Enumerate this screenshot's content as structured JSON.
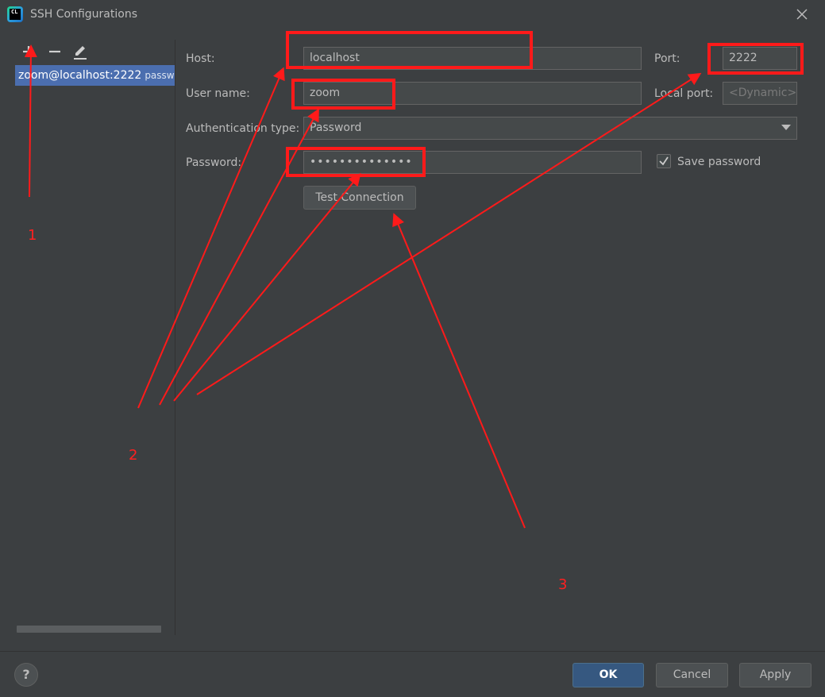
{
  "window": {
    "title": "SSH Configurations",
    "app_icon": "clion-icon",
    "app_icon_text": "CL"
  },
  "toolbar": {
    "add_icon": "plus-icon",
    "remove_icon": "minus-icon",
    "edit_icon": "pencil-icon"
  },
  "config_list": {
    "items": [
      {
        "label": "zoom@localhost:2222",
        "sub": "password"
      }
    ]
  },
  "form": {
    "host_label": "Host:",
    "host_value": "localhost",
    "port_label": "Port:",
    "port_value": "2222",
    "user_label": "User name:",
    "user_value": "zoom",
    "local_port_label": "Local port:",
    "local_port_placeholder": "<Dynamic>",
    "auth_label": "Authentication type:",
    "auth_value": "Password",
    "password_label": "Password:",
    "password_value": "••••••••••••••",
    "save_password_label": "Save password",
    "save_password_checked": true,
    "test_connection_label": "Test Connection"
  },
  "footer": {
    "help_label": "?",
    "ok_label": "OK",
    "cancel_label": "Cancel",
    "apply_label": "Apply"
  },
  "annotations": {
    "color": "#ff1a1a",
    "labels": [
      "1",
      "2",
      "3"
    ]
  },
  "colors": {
    "background": "#3c3f41",
    "selection": "#4b6eaf",
    "default_button": "#365880"
  }
}
